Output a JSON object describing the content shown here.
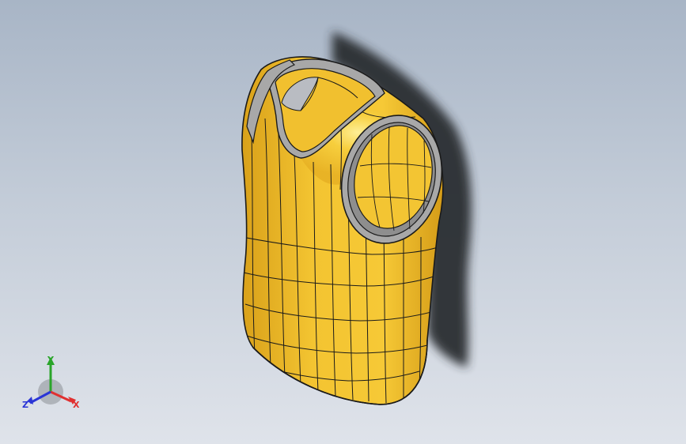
{
  "viewport": {
    "background_top": "#a8b5c6",
    "background_bottom": "#dfe3ea"
  },
  "model": {
    "part_name": "vest-shell",
    "surface_color": "#f2c12e",
    "surface_shade_color": "#d49a14",
    "edge_color": "#1a1a1a",
    "rim_color": "#a8a8a8",
    "shadow_color": "#2b2e33"
  },
  "triad": {
    "x_label": "X",
    "y_label": "Y",
    "z_label": "Z",
    "x_color": "#e03030",
    "y_color": "#2aa52a",
    "z_color": "#2a35d6"
  }
}
